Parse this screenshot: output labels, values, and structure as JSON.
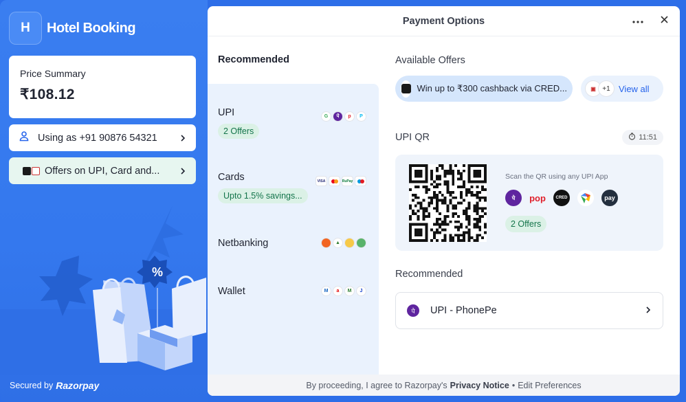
{
  "brand": {
    "logo_letter": "H",
    "name": "Hotel Booking"
  },
  "price_summary": {
    "label": "Price Summary",
    "amount": "₹108.12"
  },
  "user": {
    "text": "Using as +91 90876 54321"
  },
  "offers_banner": {
    "text": "Offers on UPI, Card and..."
  },
  "secured": {
    "prefix": "Secured by",
    "brand": "Razorpay"
  },
  "modal": {
    "title": "Payment Options",
    "more_icon": "more-horizontal-icon",
    "close_icon": "close-icon"
  },
  "methods": {
    "title": "Recommended",
    "items": [
      {
        "label": "UPI",
        "badge": "2 Offers",
        "icons": [
          "gpay",
          "phonepe",
          "pop",
          "paytm"
        ]
      },
      {
        "label": "Cards",
        "badge": "Upto 1.5% savings...",
        "icons": [
          "visa",
          "mastercard",
          "rupay",
          "maestro"
        ]
      },
      {
        "label": "Netbanking",
        "badge": "",
        "icons": [
          "bank1",
          "bank2",
          "bank3",
          "bank4"
        ]
      },
      {
        "label": "Wallet",
        "badge": "",
        "icons": [
          "mobikwik",
          "airtel",
          "amazon",
          "jio"
        ]
      }
    ]
  },
  "offers": {
    "title": "Available Offers",
    "chip_text": "Win up to ₹300 cashback via CRED...",
    "more_count": "+1",
    "view_all": "View all"
  },
  "upi_qr": {
    "title": "UPI QR",
    "timer": "11:51",
    "scan_text": "Scan the QR using any UPI App",
    "apps": [
      {
        "name": "PhonePe",
        "color": "#5f259f",
        "glyph": "पे"
      },
      {
        "name": "POP",
        "color": "#ffffff",
        "glyph": "pop"
      },
      {
        "name": "CRED",
        "color": "#111111",
        "glyph": "CRED"
      },
      {
        "name": "Google Pay",
        "color": "#ffffff",
        "glyph": "G"
      },
      {
        "name": "Amazon Pay",
        "color": "#232f3e",
        "glyph": "pay"
      }
    ],
    "badge": "2 Offers"
  },
  "recommended": {
    "title": "Recommended",
    "item": "UPI - PhonePe"
  },
  "footer": {
    "prefix": "By proceeding, I agree to Razorpay's",
    "privacy": "Privacy Notice",
    "sep": "•",
    "edit": "Edit Preferences"
  },
  "colors": {
    "brand_blue": "#2d6ee8",
    "accent_link": "#2563eb",
    "offer_green": "#13744a",
    "offer_green_bg": "#dbf1e6"
  }
}
